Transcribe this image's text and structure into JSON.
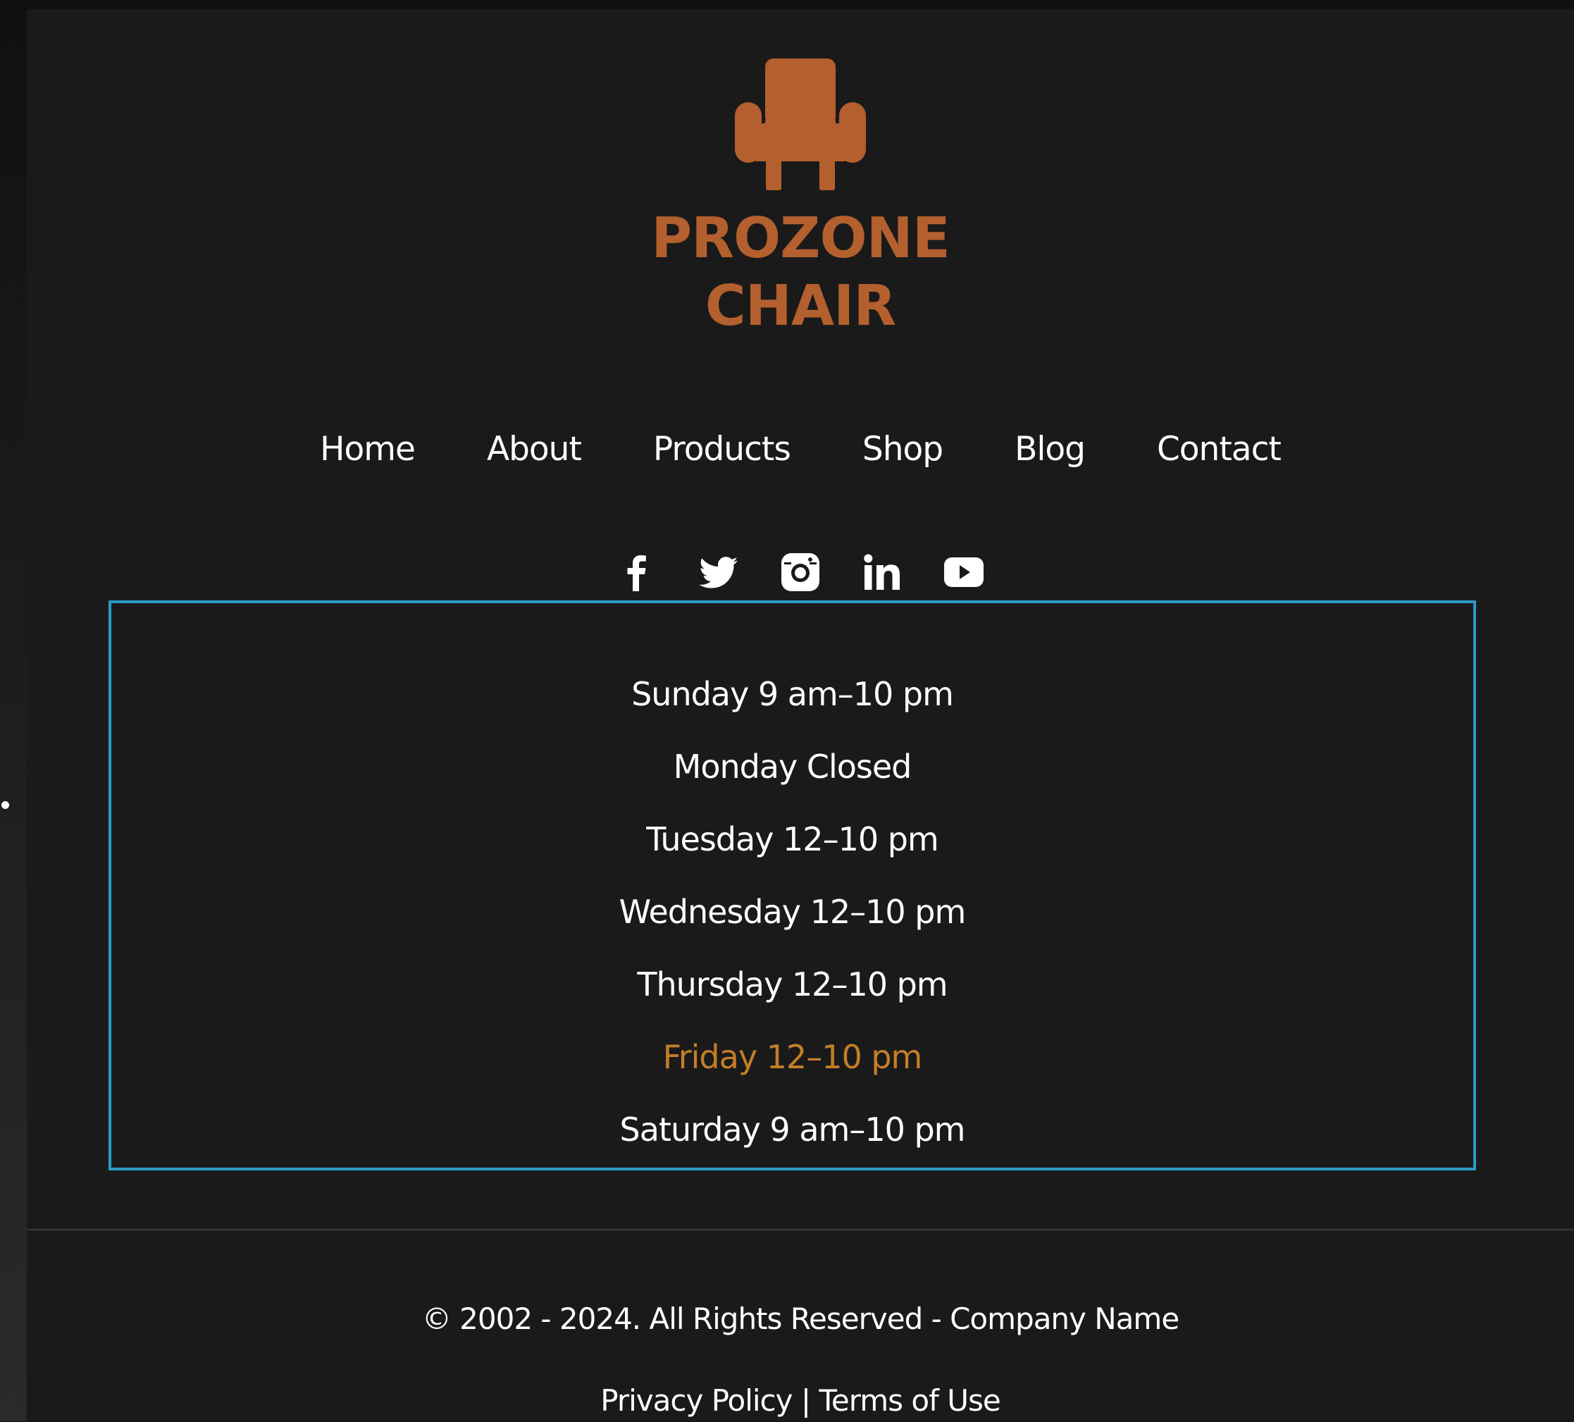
{
  "brand": {
    "line1": "PROZONE",
    "line2": "CHAIR",
    "color": "#b45f2e",
    "icon": "armchair-icon"
  },
  "nav": {
    "items": [
      {
        "label": "Home"
      },
      {
        "label": "About"
      },
      {
        "label": "Products"
      },
      {
        "label": "Shop"
      },
      {
        "label": "Blog"
      },
      {
        "label": "Contact"
      }
    ]
  },
  "social": {
    "icons": [
      "facebook-icon",
      "twitter-icon",
      "instagram-icon",
      "linkedin-icon",
      "youtube-icon"
    ]
  },
  "hours": {
    "border_color": "#2b9ac7",
    "highlight_color": "#c47e28",
    "rows": [
      {
        "text": "Sunday 9 am–10 pm"
      },
      {
        "text": "Monday Closed"
      },
      {
        "text": "Tuesday 12–10 pm"
      },
      {
        "text": "Wednesday 12–10 pm"
      },
      {
        "text": "Thursday 12–10 pm"
      },
      {
        "text": "Friday 12–10 pm",
        "highlighted": true
      },
      {
        "text": "Saturday 9 am–10 pm"
      }
    ]
  },
  "footer": {
    "copyright": "© 2002 - 2024. All Rights Reserved - Company Name",
    "privacy_label": "Privacy Policy",
    "separator": " | ",
    "terms_label": "Terms of Use"
  }
}
